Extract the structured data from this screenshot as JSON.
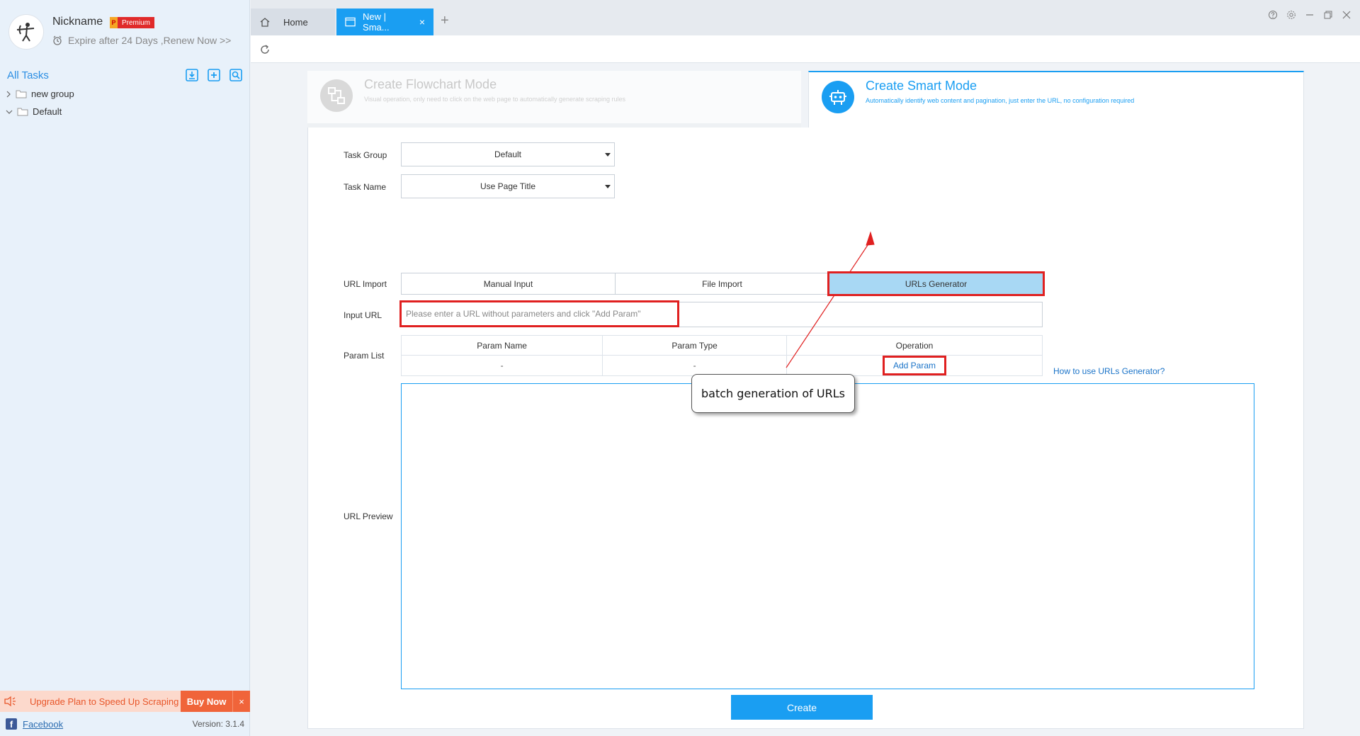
{
  "profile": {
    "nickname": "Nickname",
    "badge_letter": "P",
    "badge_text": "Premium",
    "expire_text": "Expire after 24 Days ,Renew Now >>"
  },
  "sidebar": {
    "title": "All Tasks",
    "icons": [
      "import-icon",
      "add-task-icon",
      "search-task-icon"
    ],
    "tree": [
      {
        "label": "new group",
        "expanded": false
      },
      {
        "label": "Default",
        "expanded": true
      }
    ],
    "upgrade_text": "Upgrade Plan to Speed Up Scraping",
    "buy_now": "Buy Now",
    "close": "×",
    "facebook": "Facebook",
    "version": "Version: 3.1.4"
  },
  "tabs": {
    "home": "Home",
    "active": "New | Sma...",
    "close": "×",
    "add": "+"
  },
  "modes": {
    "flowchart": {
      "title": "Create Flowchart Mode",
      "desc": "Visual operation, only need to click on the web page to automatically generate scraping rules"
    },
    "smart": {
      "title": "Create Smart Mode",
      "desc": "Automatically identify web content and pagination, just enter the URL, no configuration required"
    }
  },
  "form": {
    "task_group_label": "Task Group",
    "task_group_value": "Default",
    "task_name_label": "Task Name",
    "task_name_value": "Use Page Title",
    "url_import_label": "URL Import",
    "url_import_options": [
      "Manual Input",
      "File Import",
      "URLs Generator"
    ],
    "url_import_selected": "URLs Generator",
    "input_url_label": "Input URL",
    "input_url_placeholder": "Please enter a URL without parameters and click \"Add Param\"",
    "param_list_label": "Param List",
    "param_headers": [
      "Param Name",
      "Param Type",
      "Operation"
    ],
    "param_row": [
      "-",
      "-"
    ],
    "add_param": "Add Param",
    "help_link": "How to use URLs Generator?",
    "url_preview_label": "URL Preview",
    "create_button": "Create"
  },
  "annotation": {
    "callout": "batch generation of URLs",
    "highlight_color": "#e02020"
  },
  "colors": {
    "accent": "#1a9ef2",
    "selected_segment": "#a8d8f4",
    "upgrade_bg": "#f0643a"
  }
}
